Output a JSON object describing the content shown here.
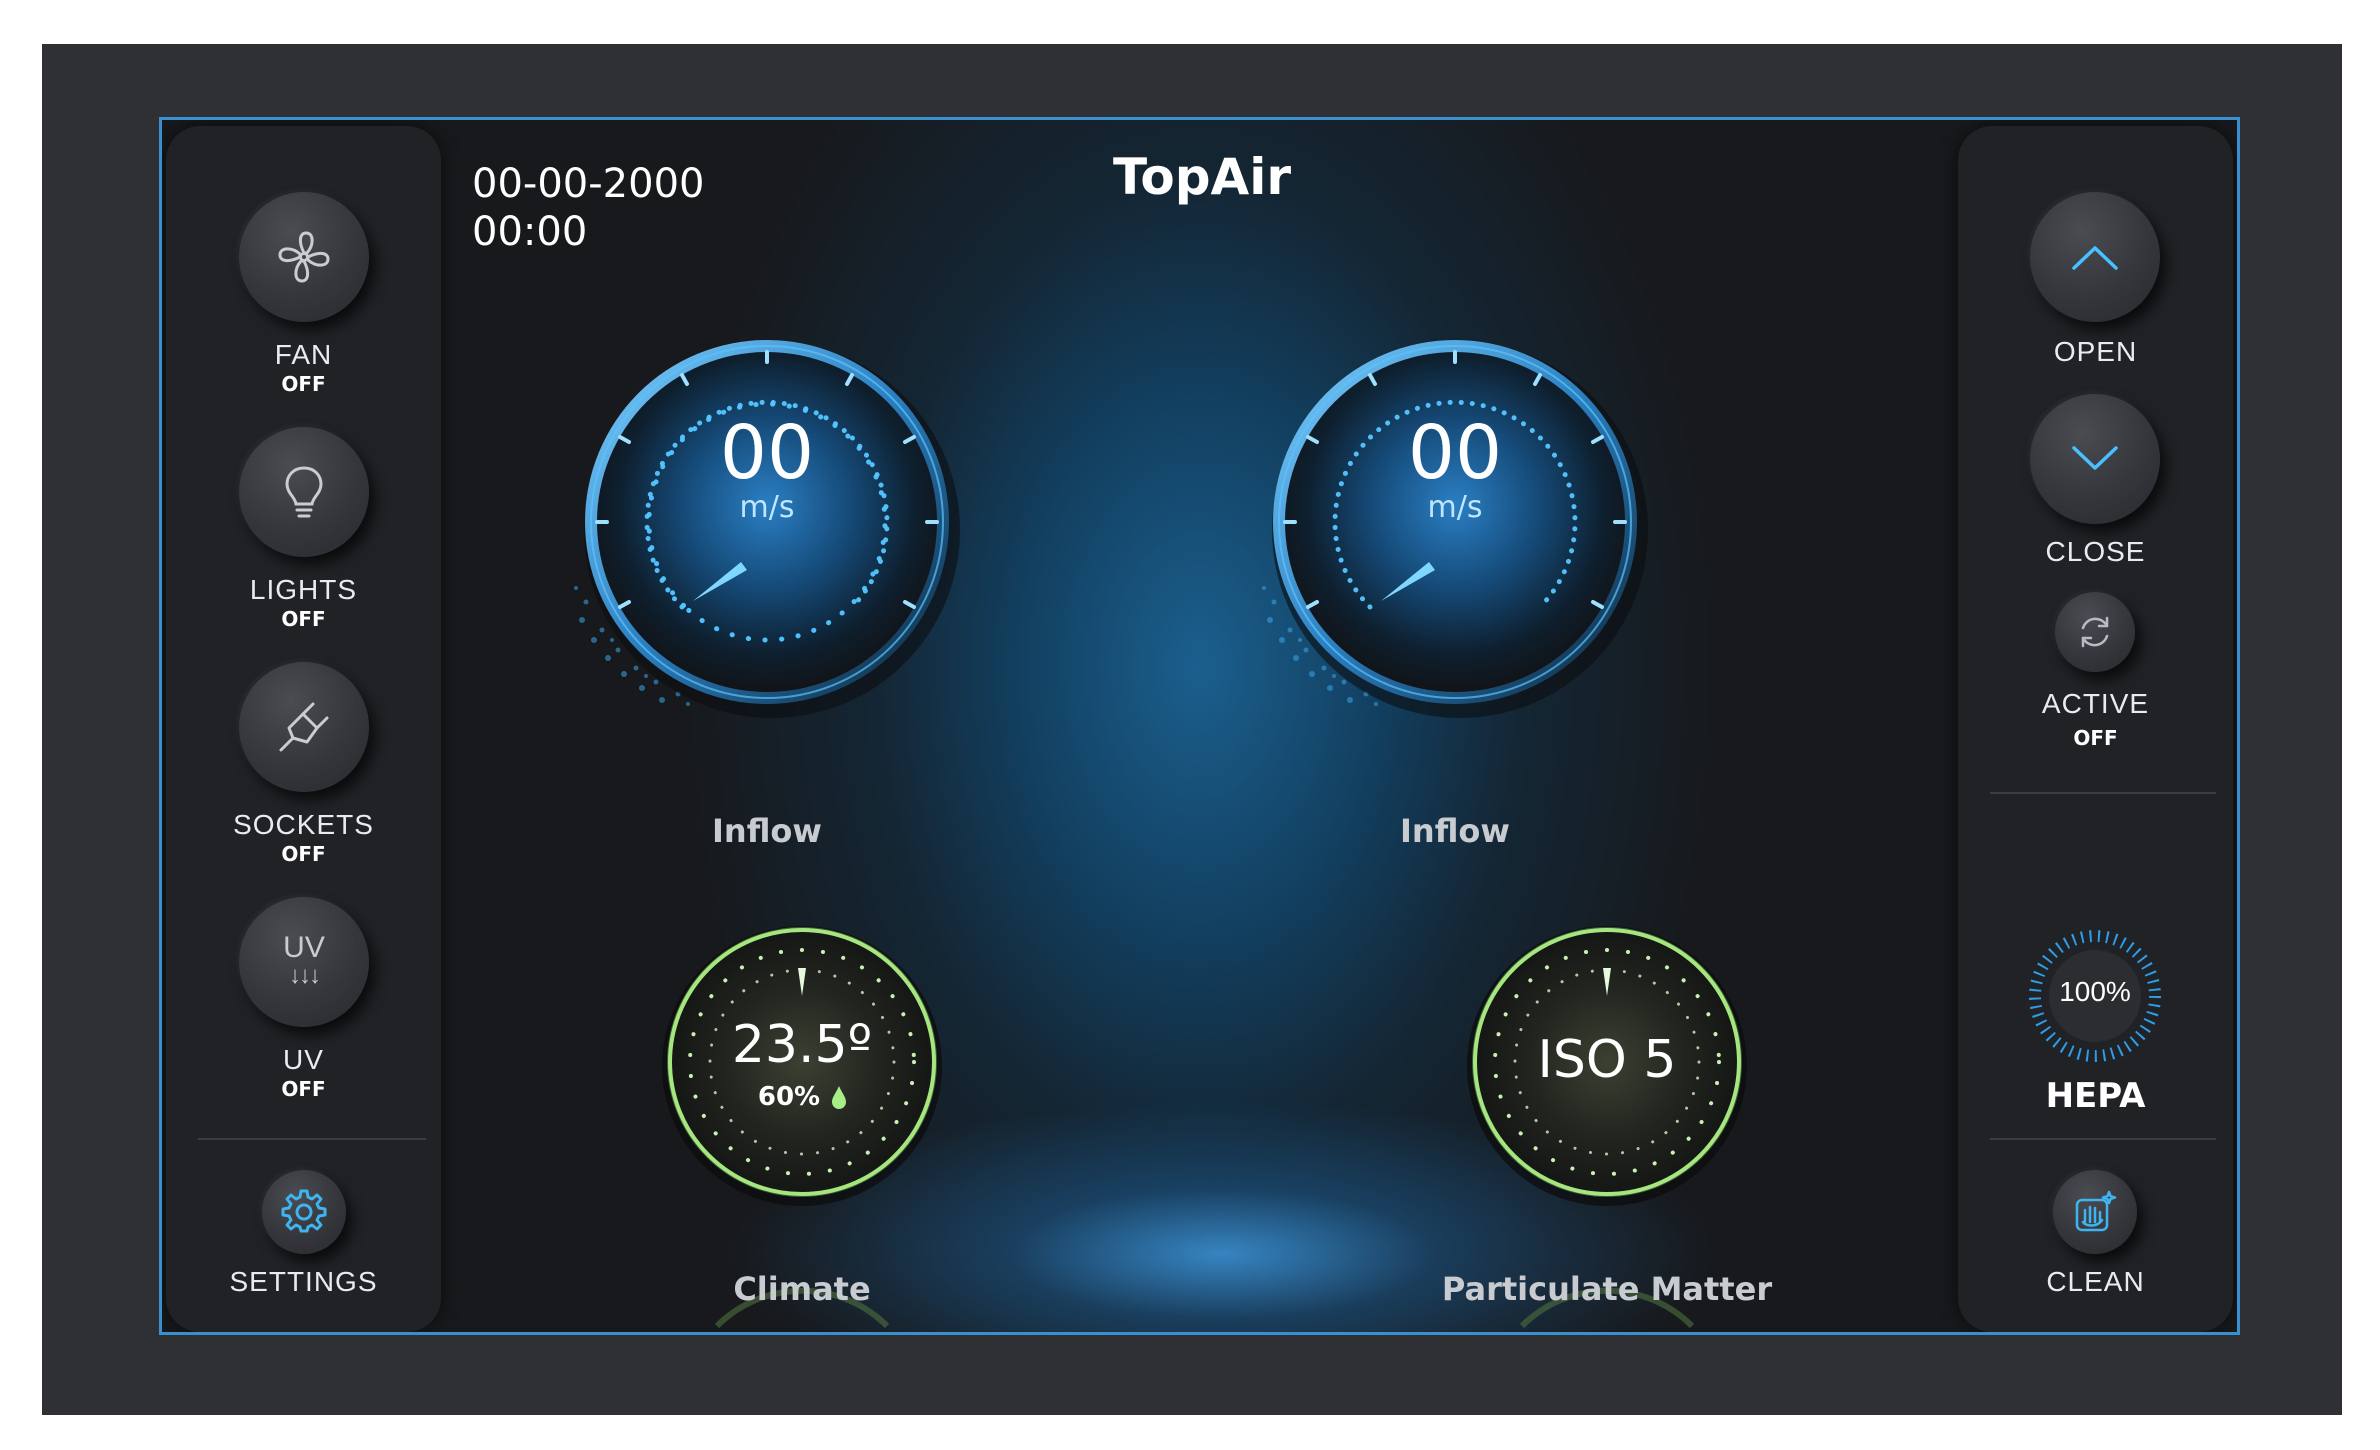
{
  "header": {
    "app_title": "TopAir",
    "date": "00-00-2000",
    "time": "00:00"
  },
  "left_panel": {
    "controls": [
      {
        "label": "FAN",
        "state": "OFF",
        "icon": "fan-icon"
      },
      {
        "label": "LIGHTS",
        "state": "OFF",
        "icon": "lightbulb-icon"
      },
      {
        "label": "SOCKETS",
        "state": "OFF",
        "icon": "plug-icon"
      },
      {
        "label": "UV",
        "state": "OFF",
        "icon": "uv-icon",
        "icon_text": "UV",
        "icon_arrows": "↓↓↓"
      }
    ],
    "settings": {
      "label": "SETTINGS",
      "icon": "gear-icon"
    }
  },
  "right_panel": {
    "open": {
      "label": "OPEN",
      "icon": "chevron-up-icon"
    },
    "close": {
      "label": "CLOSE",
      "icon": "chevron-down-icon"
    },
    "active": {
      "label": "ACTIVE",
      "state": "OFF",
      "icon": "refresh-icon"
    },
    "hepa": {
      "label": "HEPA",
      "value": "100%",
      "level": 100
    },
    "clean": {
      "label": "CLEAN",
      "icon": "cleaning-hand-icon"
    }
  },
  "gauges": {
    "inflow_left": {
      "label": "Inflow",
      "value": "00",
      "unit": "m/s"
    },
    "inflow_right": {
      "label": "Inflow",
      "value": "00",
      "unit": "m/s"
    },
    "climate": {
      "label": "Climate",
      "temperature": "23.5º",
      "humidity": "60%"
    },
    "particulate": {
      "label": "Particulate Matter",
      "value": "ISO 5"
    }
  },
  "colors": {
    "accent_blue": "#3fb4f0",
    "accent_green": "#9be07a",
    "panel_bg": "#202226",
    "frame_border": "#3a8fd0"
  }
}
